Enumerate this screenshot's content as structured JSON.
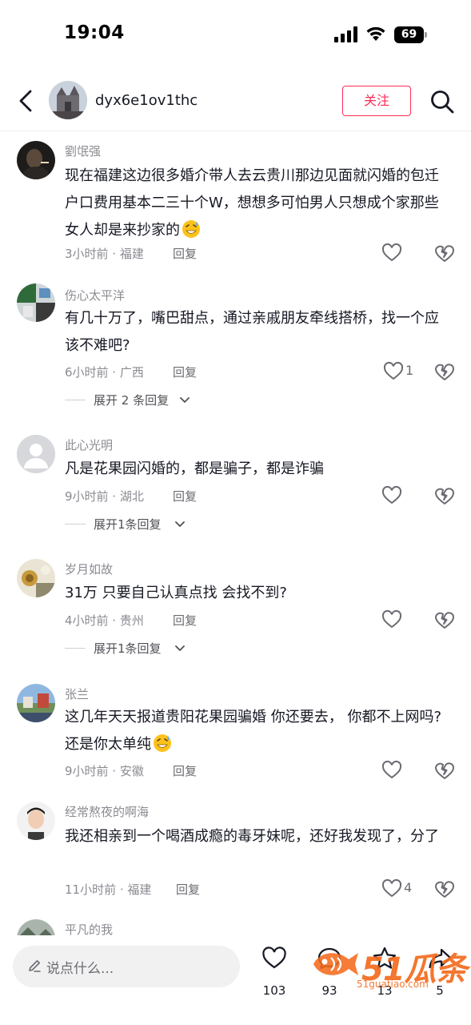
{
  "status_bar": {
    "time": "19:04",
    "battery": "69"
  },
  "header": {
    "username": "dyx6e1ov1thc",
    "follow_label": "关注"
  },
  "comments": [
    {
      "author": "劉氓强",
      "text": "现在福建这边很多婚介带人去云贵川那边见面就闪婚的包迁户口费用基本二三十个W，想想多可怕男人只想成个家那些女人却是来抄家的",
      "emoji": "grinning-sweat-emoji",
      "meta": "3小时前 · 福建",
      "reply_label": "回复",
      "likes": ""
    },
    {
      "author": "伤心太平洋",
      "text": "有几十万了，嘴巴甜点，通过亲戚朋友牵线搭桥，找一个应该不难吧?",
      "meta": "6小时前 · 广西",
      "reply_label": "回复",
      "likes": "1",
      "expand_label": "展开 2 条回复"
    },
    {
      "author": "此心光明",
      "text": "凡是花果园闪婚的，都是骗子，都是诈骗",
      "meta": "9小时前 · 湖北",
      "reply_label": "回复",
      "likes": "",
      "expand_label": "展开1条回复"
    },
    {
      "author": "岁月如故",
      "text": "31万  只要自己认真点找 会找不到?",
      "meta": "4小时前 · 贵州",
      "reply_label": "回复",
      "likes": "",
      "expand_label": "展开1条回复"
    },
    {
      "author": "张兰",
      "text": "这几年天天报道贵阳花果园骗婚 你还要去， 你都不上网吗? 还是你太单纯",
      "emoji": "grinning-sweat-emoji",
      "meta": "9小时前 · 安徽",
      "reply_label": "回复",
      "likes": ""
    },
    {
      "author": "经常熬夜的啊海",
      "text": "我还相亲到一个喝酒成瘾的毒牙妹呢，还好我发现了，分了",
      "meta": "11小时前 · 福建",
      "reply_label": "回复",
      "likes": "4"
    },
    {
      "author": "平凡的我"
    }
  ],
  "bottom_bar": {
    "input_placeholder": "说点什么...",
    "like_count": "103",
    "comment_count": "93",
    "favorite_count": "13",
    "share_count": "5"
  },
  "watermark": {
    "brand": "51瓜条",
    "url": "51guatiao.com"
  },
  "colors": {
    "accent": "#fe2c55",
    "text": "#161823",
    "muted": "#8a8b91",
    "watermark": "#f46b1e"
  }
}
